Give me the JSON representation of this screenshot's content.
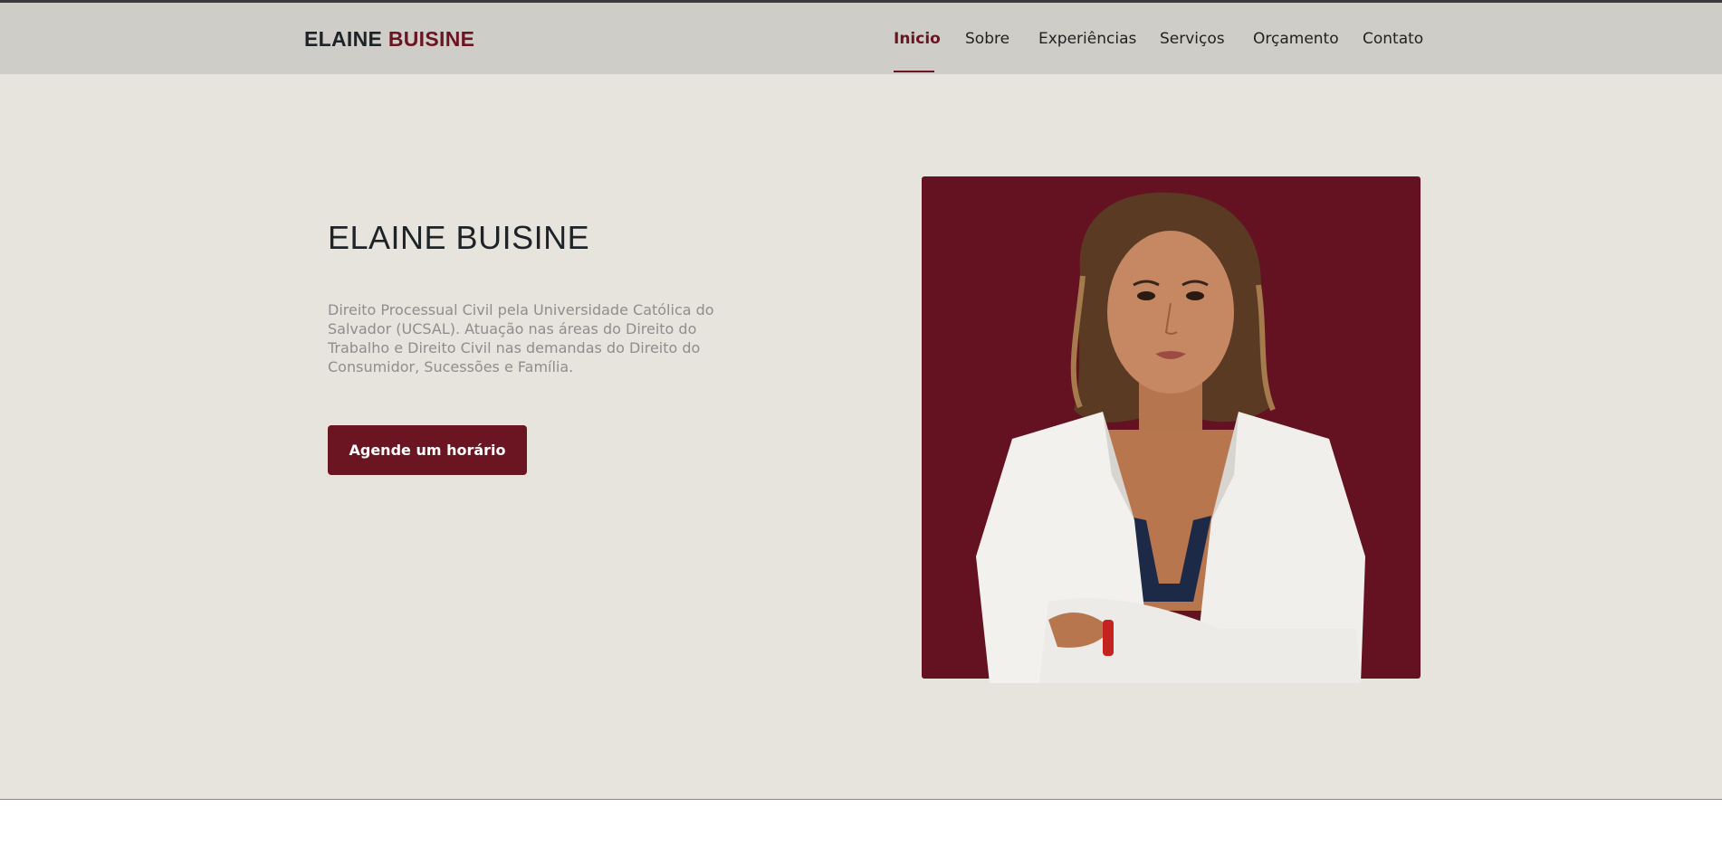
{
  "brand": {
    "first": "ELAINE",
    "second": "BUISINE"
  },
  "nav": {
    "items": [
      {
        "label": "Inicio",
        "active": true
      },
      {
        "label": "Sobre"
      },
      {
        "label": "Experiências"
      },
      {
        "label": "Serviços"
      },
      {
        "label": "Orçamento"
      },
      {
        "label": "Contato"
      }
    ]
  },
  "hero": {
    "title": "ELAINE BUISINE",
    "description": "Direito Processual Civil pela Universidade Católica do Salvador (UCSAL). Atuação nas áreas do Direito do Trabalho e Direito Civil nas demandas do Direito do Consumidor, Sucessões e Família.",
    "cta_label": "Agende um horário"
  },
  "colors": {
    "accent": "#6b1523",
    "navbar_bg": "#cfcdc7",
    "hero_bg": "#e7e3dd",
    "photo_bg": "#641221"
  }
}
